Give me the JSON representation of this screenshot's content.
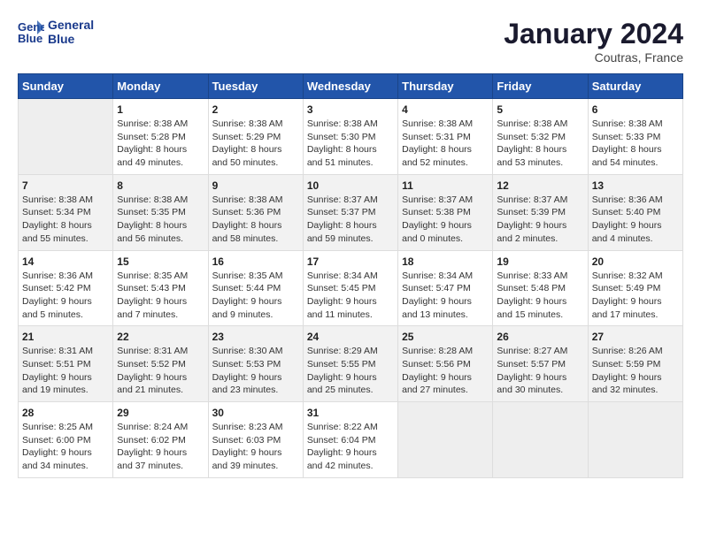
{
  "header": {
    "logo_line1": "General",
    "logo_line2": "Blue",
    "month": "January 2024",
    "location": "Coutras, France"
  },
  "days_of_week": [
    "Sunday",
    "Monday",
    "Tuesday",
    "Wednesday",
    "Thursday",
    "Friday",
    "Saturday"
  ],
  "weeks": [
    [
      {
        "num": "",
        "info": ""
      },
      {
        "num": "1",
        "info": "Sunrise: 8:38 AM\nSunset: 5:28 PM\nDaylight: 8 hours\nand 49 minutes."
      },
      {
        "num": "2",
        "info": "Sunrise: 8:38 AM\nSunset: 5:29 PM\nDaylight: 8 hours\nand 50 minutes."
      },
      {
        "num": "3",
        "info": "Sunrise: 8:38 AM\nSunset: 5:30 PM\nDaylight: 8 hours\nand 51 minutes."
      },
      {
        "num": "4",
        "info": "Sunrise: 8:38 AM\nSunset: 5:31 PM\nDaylight: 8 hours\nand 52 minutes."
      },
      {
        "num": "5",
        "info": "Sunrise: 8:38 AM\nSunset: 5:32 PM\nDaylight: 8 hours\nand 53 minutes."
      },
      {
        "num": "6",
        "info": "Sunrise: 8:38 AM\nSunset: 5:33 PM\nDaylight: 8 hours\nand 54 minutes."
      }
    ],
    [
      {
        "num": "7",
        "info": "Sunrise: 8:38 AM\nSunset: 5:34 PM\nDaylight: 8 hours\nand 55 minutes."
      },
      {
        "num": "8",
        "info": "Sunrise: 8:38 AM\nSunset: 5:35 PM\nDaylight: 8 hours\nand 56 minutes."
      },
      {
        "num": "9",
        "info": "Sunrise: 8:38 AM\nSunset: 5:36 PM\nDaylight: 8 hours\nand 58 minutes."
      },
      {
        "num": "10",
        "info": "Sunrise: 8:37 AM\nSunset: 5:37 PM\nDaylight: 8 hours\nand 59 minutes."
      },
      {
        "num": "11",
        "info": "Sunrise: 8:37 AM\nSunset: 5:38 PM\nDaylight: 9 hours\nand 0 minutes."
      },
      {
        "num": "12",
        "info": "Sunrise: 8:37 AM\nSunset: 5:39 PM\nDaylight: 9 hours\nand 2 minutes."
      },
      {
        "num": "13",
        "info": "Sunrise: 8:36 AM\nSunset: 5:40 PM\nDaylight: 9 hours\nand 4 minutes."
      }
    ],
    [
      {
        "num": "14",
        "info": "Sunrise: 8:36 AM\nSunset: 5:42 PM\nDaylight: 9 hours\nand 5 minutes."
      },
      {
        "num": "15",
        "info": "Sunrise: 8:35 AM\nSunset: 5:43 PM\nDaylight: 9 hours\nand 7 minutes."
      },
      {
        "num": "16",
        "info": "Sunrise: 8:35 AM\nSunset: 5:44 PM\nDaylight: 9 hours\nand 9 minutes."
      },
      {
        "num": "17",
        "info": "Sunrise: 8:34 AM\nSunset: 5:45 PM\nDaylight: 9 hours\nand 11 minutes."
      },
      {
        "num": "18",
        "info": "Sunrise: 8:34 AM\nSunset: 5:47 PM\nDaylight: 9 hours\nand 13 minutes."
      },
      {
        "num": "19",
        "info": "Sunrise: 8:33 AM\nSunset: 5:48 PM\nDaylight: 9 hours\nand 15 minutes."
      },
      {
        "num": "20",
        "info": "Sunrise: 8:32 AM\nSunset: 5:49 PM\nDaylight: 9 hours\nand 17 minutes."
      }
    ],
    [
      {
        "num": "21",
        "info": "Sunrise: 8:31 AM\nSunset: 5:51 PM\nDaylight: 9 hours\nand 19 minutes."
      },
      {
        "num": "22",
        "info": "Sunrise: 8:31 AM\nSunset: 5:52 PM\nDaylight: 9 hours\nand 21 minutes."
      },
      {
        "num": "23",
        "info": "Sunrise: 8:30 AM\nSunset: 5:53 PM\nDaylight: 9 hours\nand 23 minutes."
      },
      {
        "num": "24",
        "info": "Sunrise: 8:29 AM\nSunset: 5:55 PM\nDaylight: 9 hours\nand 25 minutes."
      },
      {
        "num": "25",
        "info": "Sunrise: 8:28 AM\nSunset: 5:56 PM\nDaylight: 9 hours\nand 27 minutes."
      },
      {
        "num": "26",
        "info": "Sunrise: 8:27 AM\nSunset: 5:57 PM\nDaylight: 9 hours\nand 30 minutes."
      },
      {
        "num": "27",
        "info": "Sunrise: 8:26 AM\nSunset: 5:59 PM\nDaylight: 9 hours\nand 32 minutes."
      }
    ],
    [
      {
        "num": "28",
        "info": "Sunrise: 8:25 AM\nSunset: 6:00 PM\nDaylight: 9 hours\nand 34 minutes."
      },
      {
        "num": "29",
        "info": "Sunrise: 8:24 AM\nSunset: 6:02 PM\nDaylight: 9 hours\nand 37 minutes."
      },
      {
        "num": "30",
        "info": "Sunrise: 8:23 AM\nSunset: 6:03 PM\nDaylight: 9 hours\nand 39 minutes."
      },
      {
        "num": "31",
        "info": "Sunrise: 8:22 AM\nSunset: 6:04 PM\nDaylight: 9 hours\nand 42 minutes."
      },
      {
        "num": "",
        "info": ""
      },
      {
        "num": "",
        "info": ""
      },
      {
        "num": "",
        "info": ""
      }
    ]
  ]
}
